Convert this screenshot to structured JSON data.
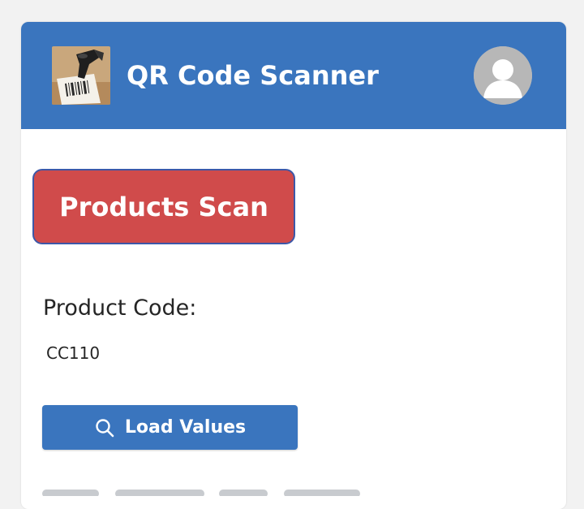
{
  "header": {
    "title": "QR Code Scanner",
    "thumbnail_icon": "barcode-scanner-photo",
    "avatar_icon": "user-avatar-icon"
  },
  "actions": {
    "scan_label": "Products Scan",
    "load_label": "Load Values",
    "load_icon": "search-icon"
  },
  "product": {
    "label": "Product Code:",
    "value": "CC110"
  },
  "colors": {
    "header": "#3a75be",
    "scan_button": "#d04b4b",
    "scan_border": "#3d58a8",
    "load_button": "#3a75be",
    "background": "#f2f2f2"
  }
}
